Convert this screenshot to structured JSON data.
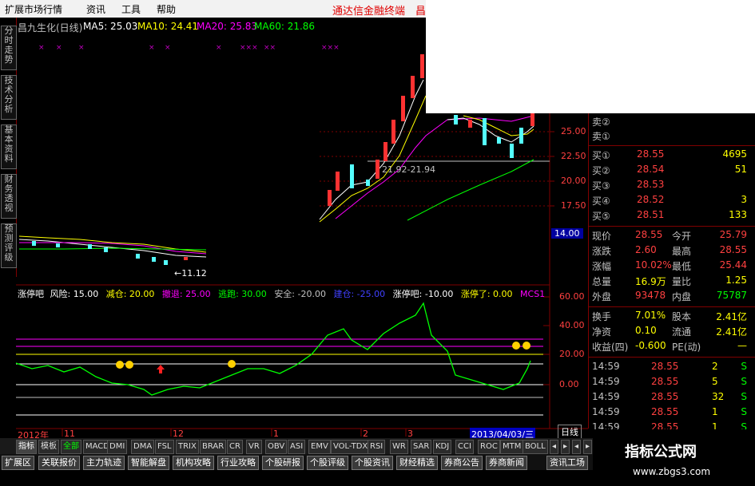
{
  "menu": {
    "items": [
      "扩展市场行情",
      "资讯",
      "工具",
      "帮助"
    ],
    "brand": "通达信金融终端",
    "brand_suffix": "昌"
  },
  "left_tabs": [
    "分时走势",
    "技术分析",
    "基本资料",
    "财务透视",
    "预测评级"
  ],
  "chart_header": {
    "stock": "昌九生化(日线)",
    "ma5": "MA5: 25.03",
    "ma10": "MA10: 24.41",
    "ma20": "MA20: 25.83",
    "ma60": "MA60: 21.86",
    "colors": {
      "ma5": "#ffffff",
      "ma10": "#ffff00",
      "ma20": "#ff00ff",
      "ma60": "#00ff00"
    }
  },
  "price_axis": [
    "25.00",
    "22.50",
    "20.00",
    "17.50",
    "14.00"
  ],
  "annotations": {
    "low_label": "←11.12",
    "range_label": "21.92-21.94"
  },
  "indicator_header": {
    "name": "涨停吧",
    "fields": [
      {
        "label": "风险: 15.00",
        "color": "#ffffff"
      },
      {
        "label": "减仓: 20.00",
        "color": "#ffff00"
      },
      {
        "label": "撤退: 25.00",
        "color": "#ff00ff"
      },
      {
        "label": "逃跑: 30.00",
        "color": "#00ff00"
      },
      {
        "label": "安全: -20.00",
        "color": "#c0c0c0"
      },
      {
        "label": "建仓: -25.00",
        "color": "#4040ff"
      },
      {
        "label": "涨停吧: -10.00",
        "color": "#ffffff"
      },
      {
        "label": "涨停了: 0.00",
        "color": "#ffff00"
      },
      {
        "label": "MCS1",
        "color": "#ff00ff"
      }
    ]
  },
  "indicator_axis": [
    "60.00",
    "40.00",
    "20.00",
    "0.00"
  ],
  "time_axis": {
    "labels": [
      "2012年",
      "11",
      "12",
      "1",
      "2",
      "3"
    ],
    "current_date": "2013/04/03/三",
    "period_label": "日线"
  },
  "quote": {
    "sell": [
      {
        "label": "卖②"
      },
      {
        "label": "卖①"
      }
    ],
    "buy": [
      {
        "label": "买①",
        "price": "28.55",
        "vol": "4695"
      },
      {
        "label": "买②",
        "price": "28.54",
        "vol": "51"
      },
      {
        "label": "买③",
        "price": "28.53",
        "vol": ""
      },
      {
        "label": "买④",
        "price": "28.52",
        "vol": "3"
      },
      {
        "label": "买⑤",
        "price": "28.51",
        "vol": "133"
      }
    ],
    "stats": [
      {
        "k1": "现价",
        "v1": "28.55",
        "k2": "今开",
        "v2": "25.79"
      },
      {
        "k1": "涨跌",
        "v1": "2.60",
        "k2": "最高",
        "v2": "28.55"
      },
      {
        "k1": "涨幅",
        "v1": "10.02%",
        "k2": "最低",
        "v2": "25.44"
      },
      {
        "k1": "总量",
        "v1": "16.9万",
        "k2": "量比",
        "v2": "1.25"
      },
      {
        "k1": "外盘",
        "v1": "93478",
        "k2": "内盘",
        "v2": "75787"
      },
      {
        "k1": "换手",
        "v1": "7.01%",
        "k2": "股本",
        "v2": "2.41亿"
      },
      {
        "k1": "净资",
        "v1": "0.10",
        "k2": "流通",
        "v2": "2.41亿"
      },
      {
        "k1": "收益(四)",
        "v1": "-0.600",
        "k2": "PE(动)",
        "v2": "—"
      }
    ],
    "ticks": [
      {
        "time": "14:59",
        "price": "28.55",
        "vol": "2",
        "side": "S"
      },
      {
        "time": "14:59",
        "price": "28.55",
        "vol": "5",
        "side": "S"
      },
      {
        "time": "14:59",
        "price": "28.55",
        "vol": "32",
        "side": "S"
      },
      {
        "time": "14:59",
        "price": "28.55",
        "vol": "1",
        "side": "S"
      },
      {
        "time": "14:59",
        "price": "28.55",
        "vol": "1",
        "side": "S"
      }
    ]
  },
  "indicator_tabs": [
    "指标",
    "模板",
    "全部",
    "MACD",
    "DMI",
    "DMA",
    "FSL",
    "TRIX",
    "BRAR",
    "CR",
    "VR",
    "OBV",
    "ASI",
    "EMV",
    "VOL-TDX",
    "RSI",
    "WR",
    "SAR",
    "KDJ",
    "CCI",
    "ROC",
    "MTM",
    "BOLL"
  ],
  "bottom_tabs": [
    "扩展区",
    "关联报价",
    "主力轨迹",
    "智能解盘",
    "机构攻略",
    "行业攻略",
    "个股研报",
    "个股评级",
    "个股资讯",
    "财经精选",
    "券商公告",
    "券商新闻",
    "资讯工场"
  ],
  "watermark": {
    "title": "指标公式网",
    "url": "www.zbgs3.com"
  }
}
